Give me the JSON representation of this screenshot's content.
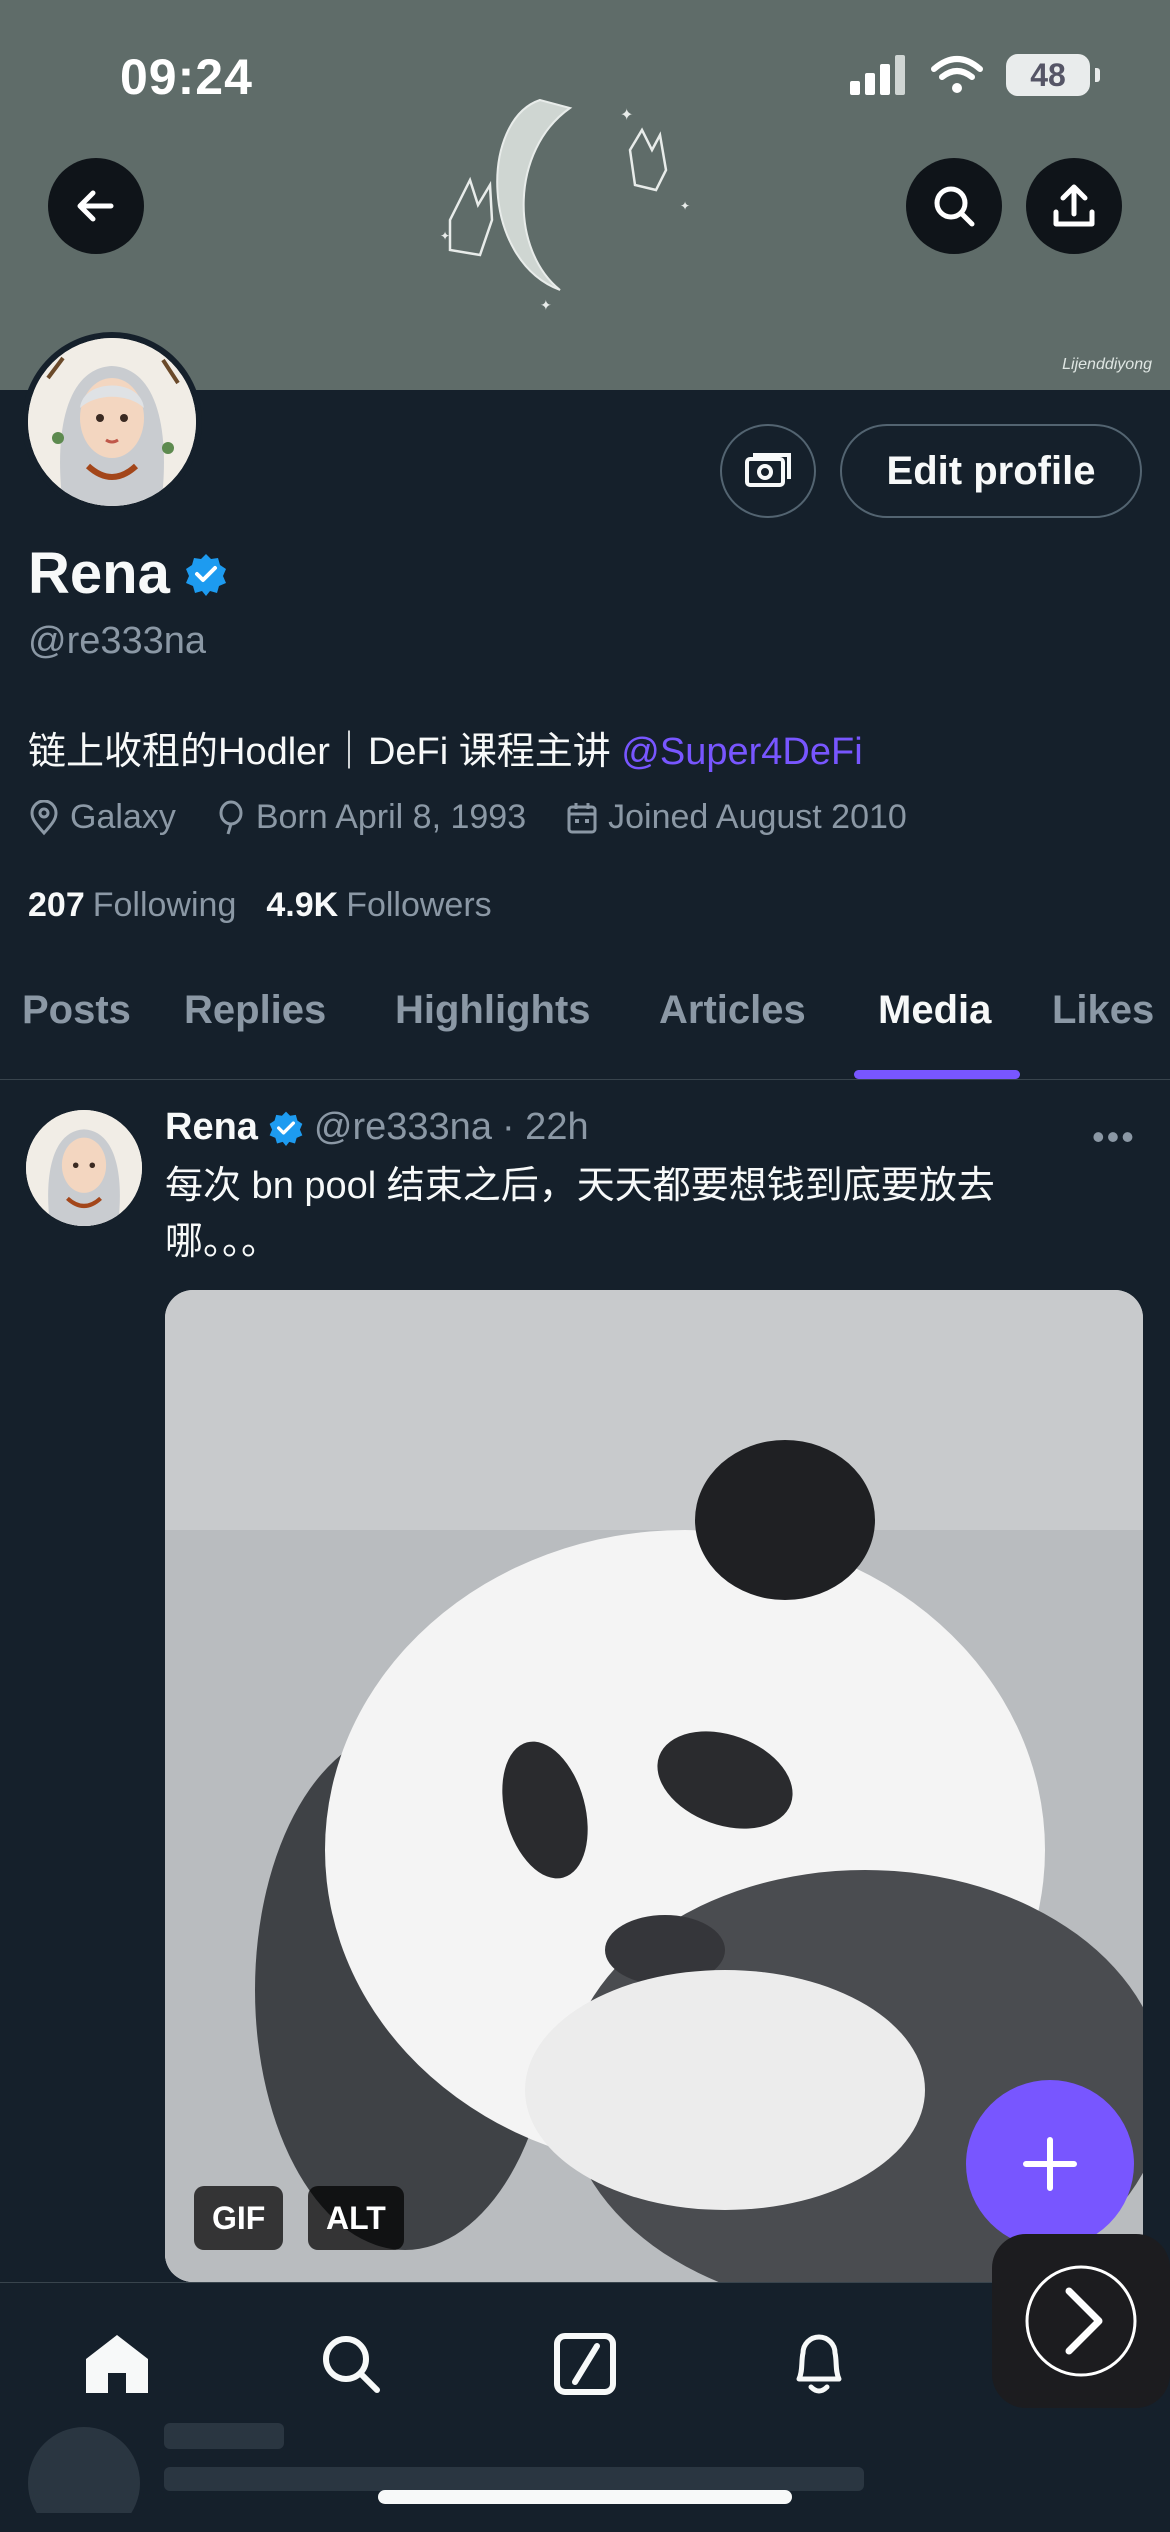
{
  "status_bar": {
    "time": "09:24",
    "battery": "48"
  },
  "banner": {
    "signature": "Lijenddiyong"
  },
  "profile": {
    "name": "Rena",
    "handle": "@re333na",
    "bio_text": "链上收租的Hodler｜DeFi 课程主讲 ",
    "bio_mention": "@Super4DeFi",
    "location": "Galaxy",
    "birthday": "Born April 8, 1993",
    "joined": "Joined August 2010",
    "following_count": "207",
    "following_label": "Following",
    "followers_count": "4.9K",
    "followers_label": "Followers",
    "edit_label": "Edit profile"
  },
  "tabs": [
    {
      "label": "Posts"
    },
    {
      "label": "Replies"
    },
    {
      "label": "Highlights"
    },
    {
      "label": "Articles"
    },
    {
      "label": "Media"
    },
    {
      "label": "Likes"
    }
  ],
  "active_tab": "Media",
  "post": {
    "name": "Rena",
    "handle": "@re333na",
    "time": "· 22h",
    "text": "每次 bn pool 结束之后，天天都要想钱到底要放去哪。。。",
    "badges": {
      "gif": "GIF",
      "alt": "ALT"
    },
    "more": "•••"
  },
  "colors": {
    "accent": "#7856ff",
    "background": "#15202b",
    "verified": "#1d9bf0"
  }
}
